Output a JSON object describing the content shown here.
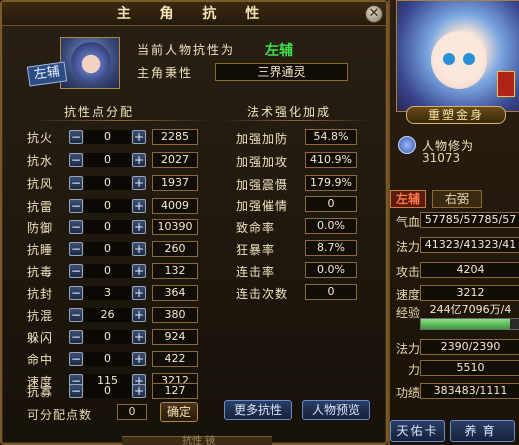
{
  "dialog": {
    "title": "主 角 抗 性",
    "close_glyph": "✕",
    "portrait_tag": "左辅",
    "current_attr_label": "当前人物抗性为",
    "current_attr_value": "左辅",
    "main_attr_label": "主角秉性",
    "main_attr_value": "三界通灵",
    "left_section_title": "抗性点分配",
    "right_section_title": "法术强化加成",
    "minus_glyph": "−",
    "plus_glyph": "+",
    "resistances": [
      {
        "name": "抗火",
        "alloc": "0",
        "total": "2285"
      },
      {
        "name": "抗水",
        "alloc": "0",
        "total": "2027"
      },
      {
        "name": "抗风",
        "alloc": "0",
        "total": "1937"
      },
      {
        "name": "抗雷",
        "alloc": "0",
        "total": "4009"
      },
      {
        "name": "防御",
        "alloc": "0",
        "total": "10390"
      },
      {
        "name": "抗睡",
        "alloc": "0",
        "total": "260"
      },
      {
        "name": "抗毒",
        "alloc": "0",
        "total": "132"
      },
      {
        "name": "抗封",
        "alloc": "3",
        "total": "364"
      },
      {
        "name": "抗混",
        "alloc": "26",
        "total": "380"
      },
      {
        "name": "躲闪",
        "alloc": "0",
        "total": "924"
      },
      {
        "name": "命中",
        "alloc": "0",
        "total": "422"
      },
      {
        "name": "速度",
        "alloc": "115",
        "total": "3212"
      },
      {
        "name": "抗寡",
        "alloc": "0",
        "total": "127"
      }
    ],
    "bonuses": [
      {
        "name": "加强加防",
        "value": "54.8%"
      },
      {
        "name": "加强加攻",
        "value": "410.9%"
      },
      {
        "name": "加强震慑",
        "value": "179.9%"
      },
      {
        "name": "加强催情",
        "value": "0"
      },
      {
        "name": "致命率",
        "value": "0.0%"
      },
      {
        "name": "狂暴率",
        "value": "8.7%"
      },
      {
        "name": "连击率",
        "value": "0.0%"
      },
      {
        "name": "连击次数",
        "value": "0"
      }
    ],
    "available_label": "可分配点数",
    "available_value": "0",
    "confirm_label": "确定",
    "more_label": "更多抗性",
    "preview_label": "人物预览",
    "bottom_fragment": "抗性  镜"
  },
  "side": {
    "rebirth_label": "重塑金身",
    "cultivation_label": "人物修为",
    "cultivation_value": "31073",
    "tab_left": "左辅",
    "tab_right": "右弼",
    "stats": [
      {
        "name": "气血",
        "value": "57785/57785/57"
      },
      {
        "name": "法力",
        "value": "41323/41323/41"
      },
      {
        "name": "攻击",
        "value": "4204"
      },
      {
        "name": "速度",
        "value": "3212"
      },
      {
        "name": "经验",
        "value": "244亿7096万/4"
      },
      {
        "name": "",
        "value": ""
      },
      {
        "name": "法力",
        "value": "2390/2390"
      },
      {
        "name": "力",
        "value": "5510"
      },
      {
        "name": "功绩",
        "value": "383483/1111"
      }
    ],
    "exp_fraction": 0.9,
    "bless_label": "天佑卡",
    "raise_label": "养育"
  }
}
